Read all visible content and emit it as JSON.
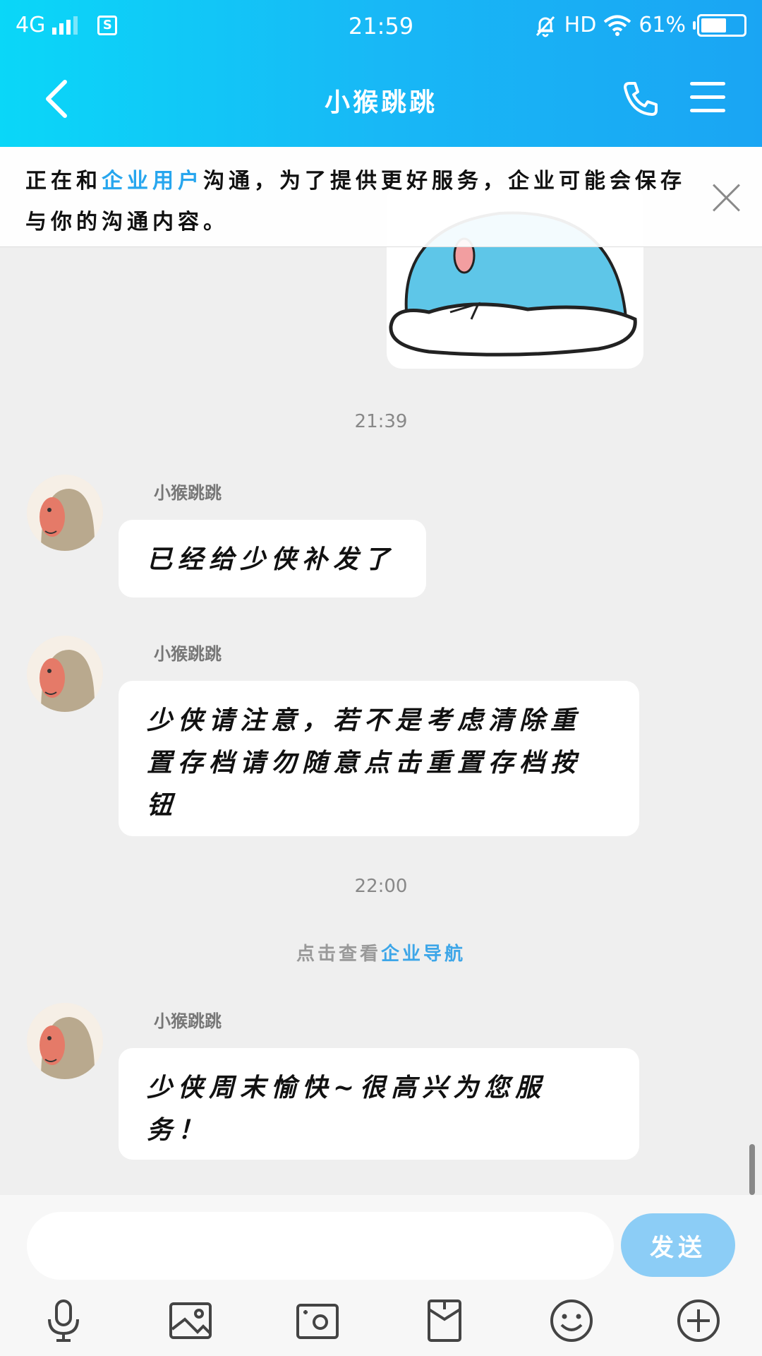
{
  "status": {
    "network": "4G",
    "time": "21:59",
    "hd": "HD",
    "battery": "61%",
    "battery_level": 0.61
  },
  "nav": {
    "title": "小猴跳跳"
  },
  "notice": {
    "prefix": "正在和",
    "highlight": "企业用户",
    "suffix": "沟通，为了提供更好服务，企业可能会保存与你的沟通内容。"
  },
  "messages": {
    "time1": "21:39",
    "sender": "小猴跳跳",
    "msg1": "已经给少侠补发了",
    "msg2": "少侠请注意，若不是考虑清除重置存档请勿随意点击重置存档按钮",
    "time2": "22:00",
    "sys_prefix": "点击查看",
    "sys_link": "企业导航",
    "msg3": "少侠周末愉快~很高兴为您服务！"
  },
  "input": {
    "placeholder": "",
    "send_label": "发送"
  },
  "colors": {
    "header_start": "#0ad7f8",
    "header_end": "#1aa5f3",
    "link": "#27a6ee",
    "send_button": "#8ccdf6"
  },
  "icons": [
    "back-icon",
    "phone-icon",
    "menu-icon",
    "close-icon",
    "mic-icon",
    "image-icon",
    "camera-icon",
    "red-packet-icon",
    "emoji-icon",
    "plus-icon"
  ]
}
